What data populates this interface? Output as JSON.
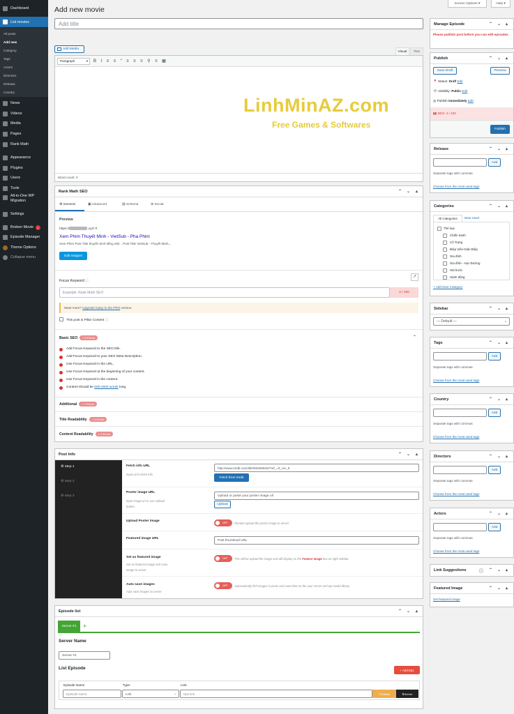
{
  "menu": {
    "dashboard": "Dashboard",
    "list_movies": "List movies",
    "sub": [
      "All posts",
      "Add new",
      "Category",
      "Tags",
      "Actors",
      "Directors",
      "Release",
      "Country"
    ],
    "items": [
      "News",
      "Videos",
      "Media",
      "Pages",
      "Rank Math",
      "Appearance",
      "Plugins",
      "Users",
      "Tools",
      "All-in-One WP",
      "Migration",
      "Settings",
      "Broken Movie",
      "Episode Manager",
      "Theme Options",
      "Collapse menu"
    ],
    "broken_count": "1"
  },
  "top": {
    "screen_options": "Screen Options",
    "help": "Help"
  },
  "page": {
    "title": "Add new movie",
    "title_placeholder": "Add title"
  },
  "editor": {
    "add_media": "Add Media",
    "tab_visual": "Visual",
    "tab_text": "Text",
    "format": "Paragraph",
    "word_count": "Word count: 0"
  },
  "watermark": {
    "brand": "LinhMinAZ.com",
    "tagline": "Free Games & Softwares"
  },
  "rankmath": {
    "title": "Rank Math SEO",
    "tabs": [
      "General",
      "Advanced",
      "Schema",
      "Social"
    ],
    "preview_label": "Preview",
    "url": "https://",
    "url_tail": ".xyz/",
    "serp_title": "Xem Phim Thuyết Minh - VietSub - Pha Phim",
    "serp_desc": "Xem Phim Post Title thuyết minh tiếng việt... Post Title VietSub - Thuyết Minh...",
    "edit_snippet": "Edit Snippet",
    "focus_keyword": "Focus Keyword",
    "kw_placeholder": "Example: Rank Math SEO",
    "kw_score": "4 / 100",
    "upgrade_pre": "Want more? ",
    "upgrade_link": "Upgrade today to the PRO",
    "upgrade_post": " version.",
    "pillar": "This post is Pillar Content",
    "basic_seo": "Basic SEO",
    "basic_errors": "× 6 Errors",
    "checks": [
      "Add Focus Keyword to the SEO title.",
      "Add Focus Keyword to your SEO Meta Description.",
      "Use Focus Keyword in the URL.",
      "Use Focus Keyword at the beginning of your content.",
      "Use Focus Keyword in the content.",
      "Content should be "
    ],
    "check_link": "600-2500 words",
    "check_tail": " long.",
    "additional": "Additional",
    "additional_errors": "× 7 Errors",
    "title_read": "Title Readability",
    "title_errors": "× 4 Errors",
    "content_read": "Content Readability",
    "content_errors": "× 3 Errors"
  },
  "postinfo": {
    "title": "Post Info",
    "steps": [
      "Step 1",
      "Step 2",
      "Step 3"
    ],
    "fetch_label": "Fetch info URL",
    "fetch_desc": "Input url to fetch info",
    "fetch_value": "http://www.imdb.com/title/tt0458525/?ref_=tt_rec_tt",
    "fetch_button": "Fetch from Imdb",
    "poster_label": "Poster image URL",
    "poster_desc": "Input image url or use Upload",
    "poster_desc2": "button.",
    "poster_placeholder": "Upload or paste your poster image url",
    "upload": "Upload",
    "upload_poster": "Upload Poster image",
    "upload_poster_desc": "Remote upload the poster image to server",
    "featured_label": "Featured image URL",
    "featured_placeholder": "Post thumbnail URL",
    "set_featured": "Set as featured image",
    "set_featured_desc1": "Set as featured image and save",
    "set_featured_desc2": "image to server",
    "set_featured_note": "This will be upload the image and will display on the ",
    "set_featured_strong": "Feature Image",
    "set_featured_note2": " box on right sidebar.",
    "autosave": "Auto save images",
    "autosave_desc": "Auto save images to server",
    "autosave_note": "Automatically find images in posts and save them to the your server and wp media library",
    "off": "OFF"
  },
  "episodes": {
    "title": "Episode list",
    "server_tab": "Server #1",
    "plus": "+",
    "server_name": "Server Name",
    "server_value": "Server #1",
    "list_title": "List Episode",
    "add_eps": "+ Add Eps",
    "col_name": "Episode Name",
    "col_type": "Type:",
    "col_link": "Link:",
    "name_placeholder": "Episode name",
    "type_value": "Link",
    "link_placeholder": "Eps link",
    "subtitle": "Subtitle",
    "server_btn": "Server"
  },
  "side": {
    "manage_episode": "Manage Episode",
    "manage_msg": "Please publish post before you can edit episodes",
    "publish": "Publish",
    "save_draft": "Save Draft",
    "preview": "Preview",
    "status_label": "Status: ",
    "status_value": "Draft",
    "visibility_label": "Visibility: ",
    "visibility_value": "Public",
    "publish_label": "Publish ",
    "publish_value": "immediately",
    "edit": "Edit",
    "seo_score": "SEO: 4 / 100",
    "publish_btn": "Publish",
    "release": "Release",
    "add": "Add",
    "separate": "Separate tags with commas",
    "choose": "Choose from the most used tags",
    "categories": "Categories",
    "cat_tab_all": "All Categories",
    "cat_tab_used": "Most Used",
    "cats": [
      "Thể loại",
      "Chiến tranh",
      "Cổ Trang",
      "Điệp Viên-Gián Điệp",
      "Gia đình",
      "Gia đình - Học Đường",
      "Hài hước",
      "Hành động"
    ],
    "add_category": "+ Add New Category",
    "sidebar": "Sidebar",
    "sidebar_default": "— Default —",
    "tags": "Tags",
    "country": "Country",
    "directors": "Directors",
    "actors": "Actors",
    "link_suggestions": "Link Suggestions",
    "featured_image": "Featured Image",
    "set_featured_image": "Set featured image"
  }
}
